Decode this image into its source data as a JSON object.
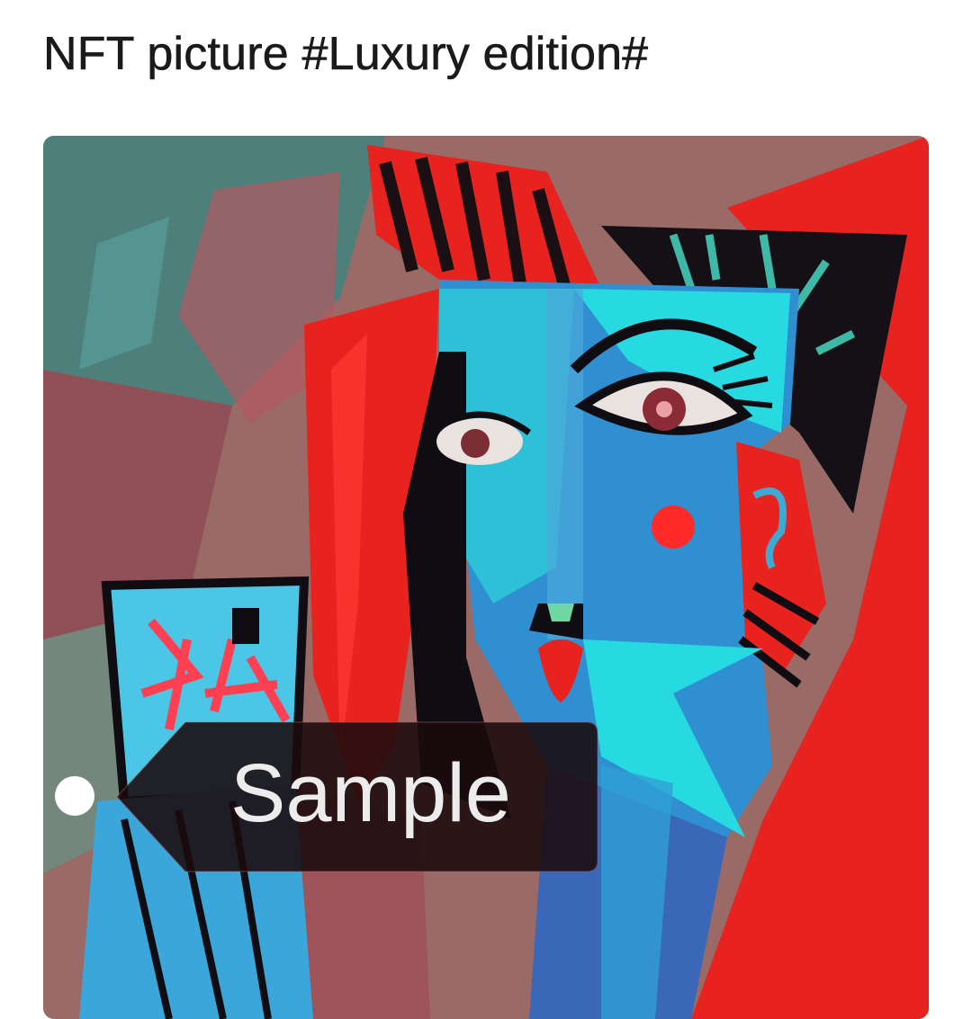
{
  "header": {
    "title": "NFT picture #Luxury edition#"
  },
  "artwork": {
    "subject": "cubist-style portrait of a woman with red hair holding a phone",
    "palette": {
      "red": "#e8231f",
      "cyan": "#27d9e0",
      "blue": "#2f8fd0",
      "dark": "#1a1013",
      "muted_rose": "#a76a66",
      "teal": "#3a8a84"
    }
  },
  "sample_tag": {
    "label": "Sample",
    "background": "#1a0a0c",
    "text_color": "#ececec"
  }
}
